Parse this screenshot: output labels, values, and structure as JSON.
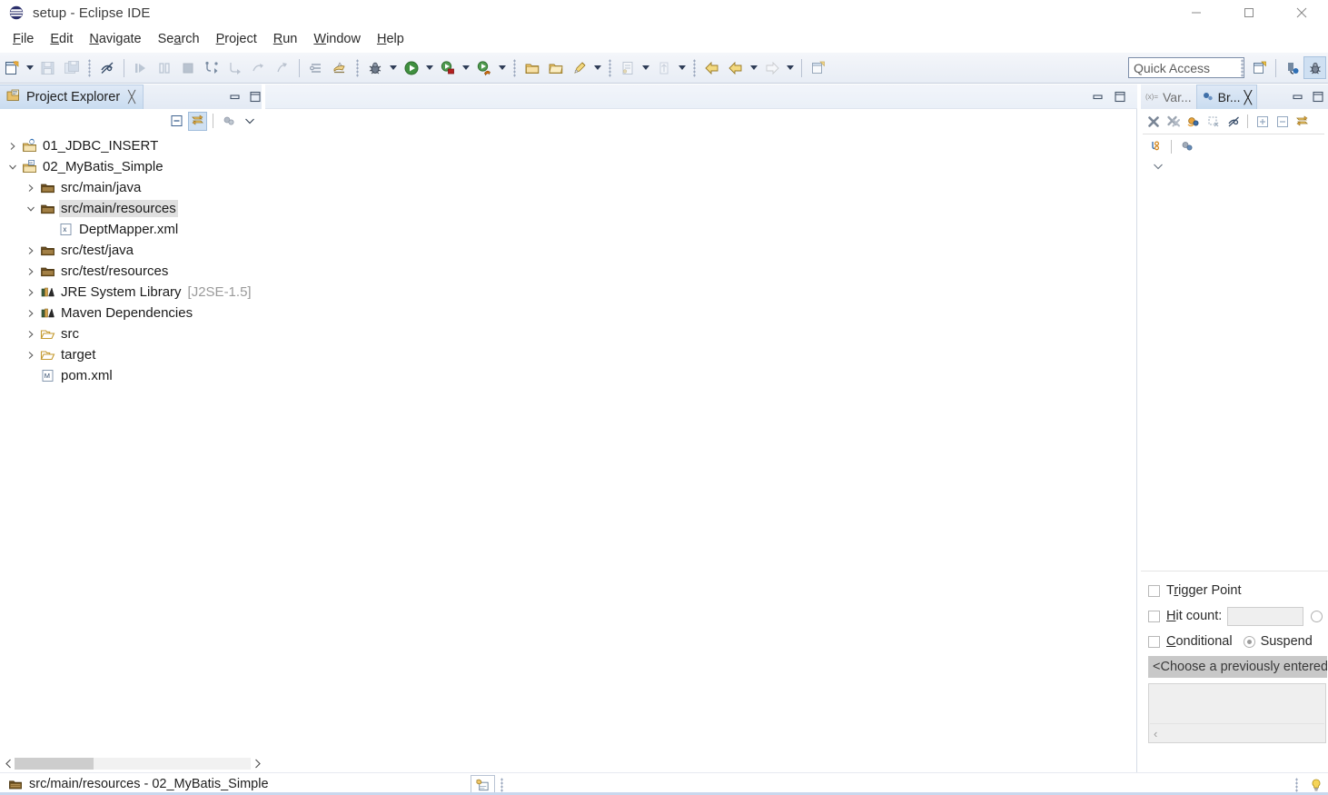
{
  "window": {
    "title": "setup - Eclipse IDE",
    "app_icon": "eclipse-logo-icon",
    "buttons": [
      {
        "name": "minimize-window-button",
        "glyph": "minimize"
      },
      {
        "name": "maximize-window-button",
        "glyph": "maximize"
      },
      {
        "name": "close-window-button",
        "glyph": "close"
      }
    ]
  },
  "menubar": {
    "items": [
      {
        "label": "File",
        "mnemonic": "F"
      },
      {
        "label": "Edit",
        "mnemonic": "E"
      },
      {
        "label": "Navigate",
        "mnemonic": "N"
      },
      {
        "label": "Search",
        "mnemonic": "a"
      },
      {
        "label": "Project",
        "mnemonic": "P"
      },
      {
        "label": "Run",
        "mnemonic": "R"
      },
      {
        "label": "Window",
        "mnemonic": "W"
      },
      {
        "label": "Help",
        "mnemonic": "H"
      }
    ]
  },
  "toolbar": {
    "quick_access": {
      "placeholder": "Quick Access",
      "value": ""
    },
    "buttons": [
      {
        "name": "new-wizard-button",
        "icon": "new-file-icon",
        "enabled": true
      },
      {
        "name": "save-button",
        "icon": "save-icon",
        "enabled": false
      },
      {
        "name": "save-all-button",
        "icon": "save-all-icon",
        "enabled": false
      },
      {
        "name": "toggle-mark-occurrences-button",
        "icon": "mark-occurrences-icon",
        "enabled": true
      },
      {
        "name": "resume-button",
        "icon": "resume-icon",
        "enabled": false
      },
      {
        "name": "suspend-button",
        "icon": "suspend-icon",
        "enabled": false
      },
      {
        "name": "terminate-button",
        "icon": "terminate-icon",
        "enabled": false
      },
      {
        "name": "step-into-selection-button",
        "icon": "step-into-selection-icon",
        "enabled": false
      },
      {
        "name": "step-into-button",
        "icon": "step-into-icon",
        "enabled": false
      },
      {
        "name": "step-over-button",
        "icon": "step-over-icon",
        "enabled": false
      },
      {
        "name": "step-return-button",
        "icon": "step-return-icon",
        "enabled": false
      },
      {
        "name": "skip-all-breakpoints-button",
        "icon": "skip-breakpoints-icon",
        "enabled": false
      },
      {
        "name": "open-task-button",
        "icon": "task-icon",
        "enabled": true
      },
      {
        "name": "debug-button",
        "icon": "debug-bug-icon",
        "enabled": true
      },
      {
        "name": "run-button",
        "icon": "run-play-icon",
        "enabled": true
      },
      {
        "name": "external-tools-button",
        "icon": "external-tools-icon",
        "enabled": true
      },
      {
        "name": "coverage-button",
        "icon": "coverage-icon",
        "enabled": true
      },
      {
        "name": "new-java-package-button",
        "icon": "package-icon",
        "enabled": true
      },
      {
        "name": "new-java-class-button",
        "icon": "class-icon",
        "enabled": true
      },
      {
        "name": "search-button",
        "icon": "search-icon",
        "enabled": true
      },
      {
        "name": "open-type-button",
        "icon": "open-type-icon",
        "enabled": false
      },
      {
        "name": "previous-annotation-button",
        "icon": "previous-annotation-icon",
        "enabled": false
      },
      {
        "name": "back-button",
        "icon": "back-arrow-icon",
        "enabled": true
      },
      {
        "name": "forward-button",
        "icon": "forward-arrow-icon",
        "enabled": true
      },
      {
        "name": "pin-editor-button",
        "icon": "pin-editor-icon",
        "enabled": true
      }
    ],
    "perspective": [
      {
        "name": "open-perspective-button",
        "icon": "open-perspective-icon",
        "active": false
      },
      {
        "name": "perspective-java-button",
        "icon": "java-perspective-icon",
        "active": false
      },
      {
        "name": "perspective-debug-button",
        "icon": "debug-perspective-icon",
        "active": true
      }
    ]
  },
  "project_explorer": {
    "tab_label": "Project Explorer",
    "tab_icon": "project-explorer-icon",
    "close_glyph": "╳",
    "view_buttons": [
      {
        "name": "collapse-all-button",
        "icon": "collapse-all-icon",
        "active": false
      },
      {
        "name": "link-with-editor-button",
        "icon": "link-with-editor-icon",
        "active": true
      },
      {
        "name": "focus-on-active-task-button",
        "icon": "focus-task-icon",
        "active": false
      },
      {
        "name": "view-menu-button",
        "icon": "chevron-down-icon",
        "active": false
      }
    ],
    "tree": [
      {
        "label": "01_JDBC_INSERT",
        "indent": 0,
        "twisty": "collapsed",
        "icon": "java-project-icon",
        "selected": false,
        "suffix": ""
      },
      {
        "label": "02_MyBatis_Simple",
        "indent": 0,
        "twisty": "expanded",
        "icon": "maven-java-project-icon",
        "selected": false,
        "suffix": ""
      },
      {
        "label": "src/main/java",
        "indent": 1,
        "twisty": "collapsed",
        "icon": "source-folder-icon",
        "selected": false,
        "suffix": ""
      },
      {
        "label": "src/main/resources",
        "indent": 1,
        "twisty": "expanded",
        "icon": "source-folder-icon",
        "selected": true,
        "suffix": ""
      },
      {
        "label": "DeptMapper.xml",
        "indent": 2,
        "twisty": "none",
        "icon": "xml-file-icon",
        "selected": false,
        "suffix": ""
      },
      {
        "label": "src/test/java",
        "indent": 1,
        "twisty": "collapsed",
        "icon": "source-folder-icon",
        "selected": false,
        "suffix": ""
      },
      {
        "label": "src/test/resources",
        "indent": 1,
        "twisty": "collapsed",
        "icon": "source-folder-icon",
        "selected": false,
        "suffix": ""
      },
      {
        "label": "JRE System Library",
        "indent": 1,
        "twisty": "collapsed",
        "icon": "library-icon",
        "selected": false,
        "suffix": "[J2SE-1.5]"
      },
      {
        "label": "Maven Dependencies",
        "indent": 1,
        "twisty": "collapsed",
        "icon": "library-icon",
        "selected": false,
        "suffix": ""
      },
      {
        "label": "src",
        "indent": 1,
        "twisty": "collapsed",
        "icon": "folder-icon",
        "selected": false,
        "suffix": ""
      },
      {
        "label": "target",
        "indent": 1,
        "twisty": "collapsed",
        "icon": "folder-icon",
        "selected": false,
        "suffix": ""
      },
      {
        "label": "pom.xml",
        "indent": 1,
        "twisty": "none",
        "icon": "maven-pom-icon",
        "selected": false,
        "suffix": ""
      }
    ]
  },
  "editor": {
    "open_tabs": [],
    "controls": [
      {
        "name": "editor-minimize-button",
        "icon": "minimize-icon"
      },
      {
        "name": "editor-maximize-button",
        "icon": "maximize-icon"
      }
    ]
  },
  "debug_views": {
    "tabs": [
      {
        "label": "Var...",
        "full_label": "Variables",
        "icon": "variables-icon",
        "active": false
      },
      {
        "label": "Br...",
        "full_label": "Breakpoints",
        "icon": "breakpoints-icon",
        "active": true
      }
    ],
    "close_glyph": "╳",
    "toolbar_row1": [
      {
        "name": "remove-breakpoint-button",
        "icon": "remove-breakpoint-icon"
      },
      {
        "name": "remove-all-breakpoints-button",
        "icon": "remove-all-breakpoints-icon"
      },
      {
        "name": "link-with-debug-view-button",
        "icon": "link-debug-view-icon"
      },
      {
        "name": "show-breakpoints-supported-button",
        "icon": "filter-breakpoints-icon"
      },
      {
        "name": "skip-all-breakpoints-button",
        "icon": "skip-all-breakpoints-icon"
      },
      {
        "name": "expand-all-button",
        "icon": "expand-all-icon"
      },
      {
        "name": "collapse-all-button",
        "icon": "collapse-all-icon"
      },
      {
        "name": "link-with-editor-button",
        "icon": "link-with-editor-icon"
      }
    ],
    "toolbar_row2": [
      {
        "name": "add-java-exception-breakpoint-button",
        "icon": "java-exception-breakpoint-icon"
      },
      {
        "name": "working-sets-button",
        "icon": "working-set-icon"
      }
    ],
    "toolbar_row3": [
      {
        "name": "view-menu-button",
        "icon": "chevron-down-icon"
      }
    ]
  },
  "breakpoint_detail": {
    "trigger_point": {
      "label": "Trigger Point",
      "mnemonic": "r",
      "checked": false
    },
    "hit_count": {
      "label": "Hit count:",
      "mnemonic": "H",
      "checked": false,
      "value": ""
    },
    "conditional": {
      "label": "Conditional",
      "mnemonic": "C",
      "checked": false
    },
    "suspend": {
      "label": "Suspend",
      "selected": true
    },
    "condition_combo": {
      "value": "<Choose a previously entered condition>"
    },
    "code_area": {
      "value": ""
    },
    "scroll_left_glyph": "‹"
  },
  "statusbar": {
    "icon": "source-folder-icon",
    "text": "src/main/resources - 02_MyBatis_Simple",
    "right_buttons": [
      {
        "name": "toggle-smart-insert-button",
        "icon": "smart-insert-icon"
      },
      {
        "name": "tip-of-the-day-button",
        "icon": "lightbulb-icon"
      }
    ]
  },
  "colors": {
    "toolbar_top": "#f4f6fa",
    "toolbar_bottom": "#e8edf5",
    "tab_active": "#c9dcf0",
    "selection": "#e0e0e0",
    "accent_blue": "#2f6fb5",
    "folder_gold": "#e8b339",
    "suffix_gray": "#9a9a9a"
  }
}
